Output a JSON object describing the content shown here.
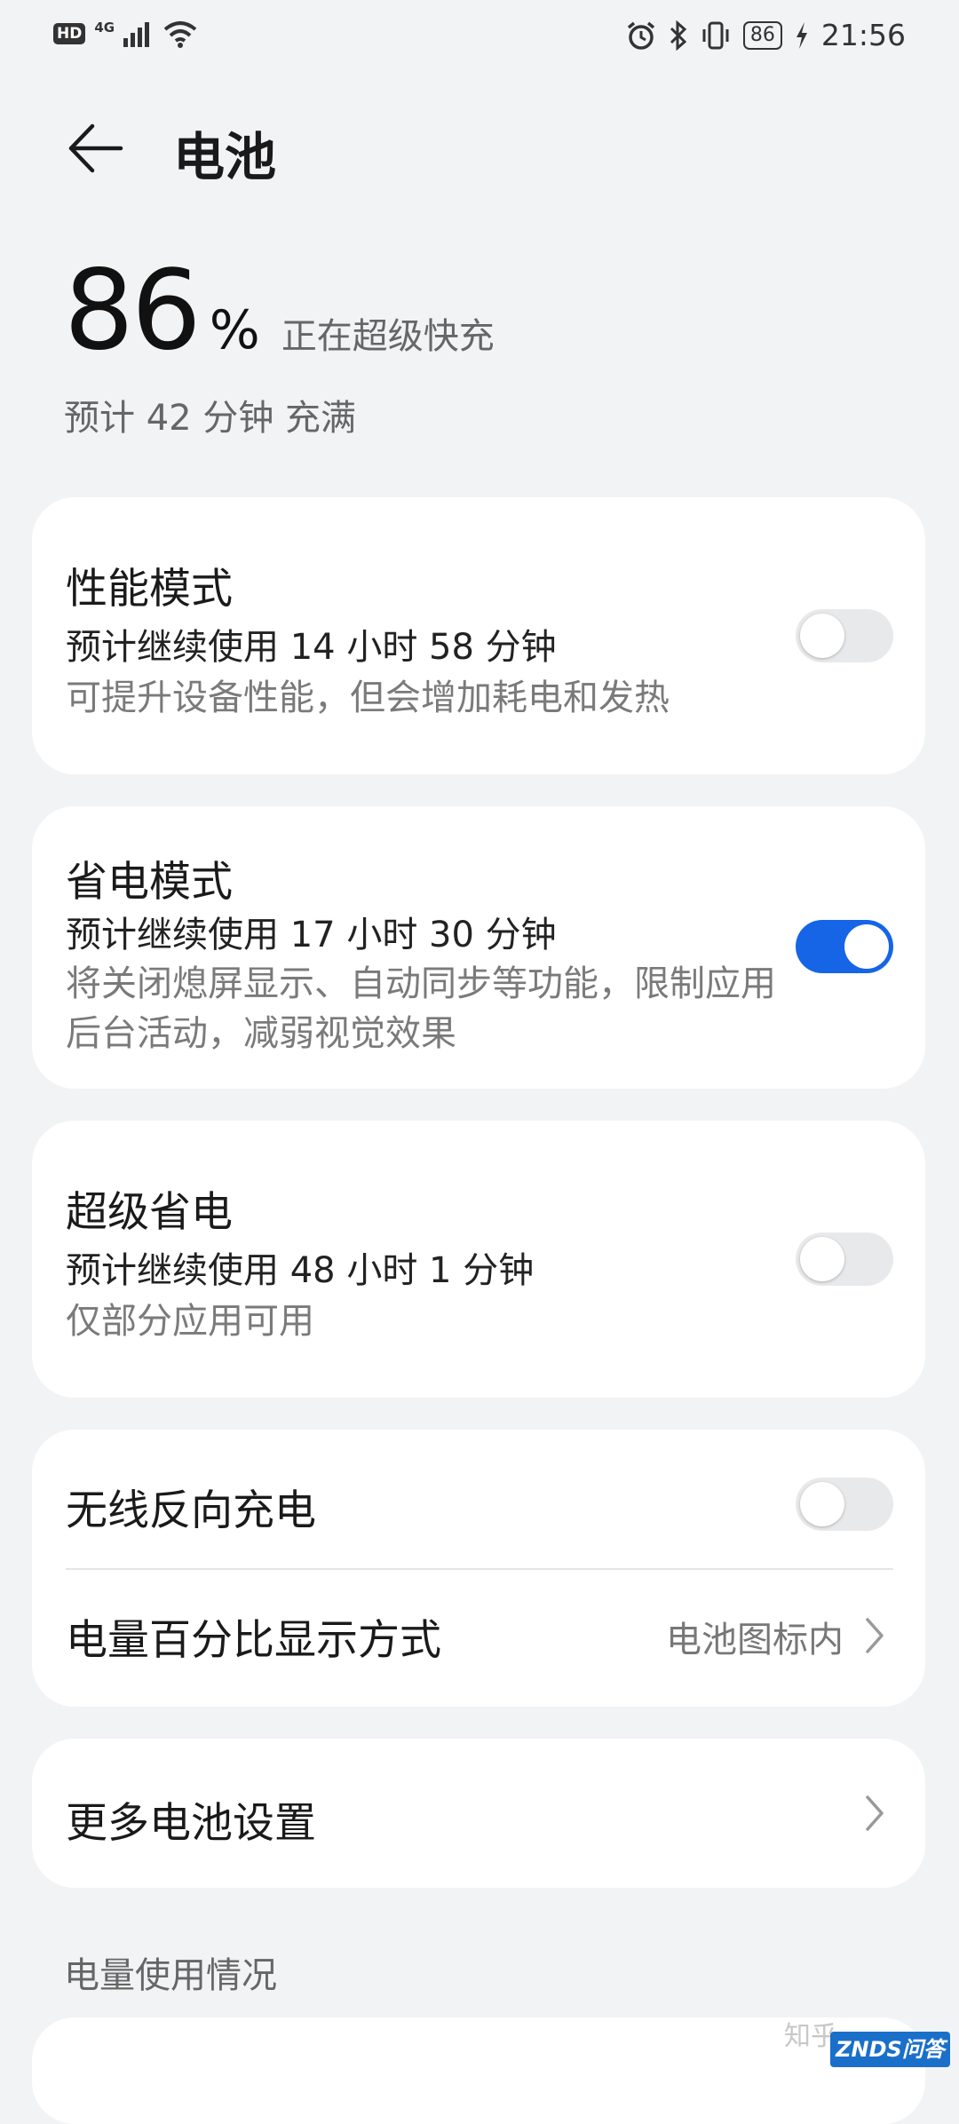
{
  "status_bar": {
    "hd": "HD",
    "network": "4G",
    "battery": "86",
    "time": "21:56"
  },
  "header": {
    "title": "电池"
  },
  "battery": {
    "percent": "86",
    "percent_sign": "%",
    "status": "正在超级快充",
    "estimate": "预计 42 分钟 充满"
  },
  "modes": [
    {
      "title": "性能模式",
      "usage": "预计继续使用 14 小时 58 分钟",
      "description": "可提升设备性能，但会增加耗电和发热",
      "enabled": false
    },
    {
      "title": "省电模式",
      "usage": "预计继续使用 17 小时 30 分钟",
      "description": "将关闭熄屏显示、自动同步等功能，限制应用后台活动，减弱视觉效果",
      "enabled": true
    },
    {
      "title": "超级省电",
      "usage": "预计继续使用 48 小时 1 分钟",
      "description": "仅部分应用可用",
      "enabled": false
    }
  ],
  "settings": {
    "wireless_reverse": {
      "label": "无线反向充电",
      "enabled": false
    },
    "percent_display": {
      "label": "电量百分比显示方式",
      "value": "电池图标内"
    },
    "more": {
      "label": "更多电池设置"
    }
  },
  "usage_section": {
    "label": "电量使用情况"
  },
  "watermarks": {
    "zhihu": "知乎",
    "znds": "ZNDS问答"
  },
  "colors": {
    "accent": "#1565e6",
    "background": "#f1f3f5",
    "card": "#ffffff"
  }
}
